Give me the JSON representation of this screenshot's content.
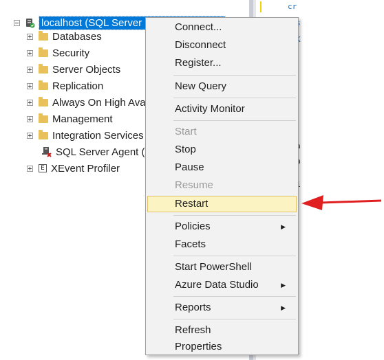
{
  "tree": {
    "server_label": "localhost (SQL Server 16.0.1000.6 - sa)",
    "items": [
      {
        "label": "Databases"
      },
      {
        "label": "Security"
      },
      {
        "label": "Server Objects"
      },
      {
        "label": "Replication"
      },
      {
        "label": "Always On High Availability"
      },
      {
        "label": "Management"
      },
      {
        "label": "Integration Services Catalogs"
      },
      {
        "label": "SQL Server Agent (Agent XPs disabled)"
      },
      {
        "label": "XEvent Profiler"
      }
    ]
  },
  "background_fragments": [
    "cr",
    "s",
    "K",
    "a",
    "a",
    "1"
  ],
  "context_menu": {
    "items": [
      {
        "label": "Connect..."
      },
      {
        "label": "Disconnect"
      },
      {
        "label": "Register..."
      },
      {
        "label": "New Query"
      },
      {
        "label": "Activity Monitor"
      },
      {
        "label": "Start"
      },
      {
        "label": "Stop"
      },
      {
        "label": "Pause"
      },
      {
        "label": "Resume"
      },
      {
        "label": "Restart"
      },
      {
        "label": "Policies"
      },
      {
        "label": "Facets"
      },
      {
        "label": "Start PowerShell"
      },
      {
        "label": "Azure Data Studio"
      },
      {
        "label": "Reports"
      },
      {
        "label": "Refresh"
      },
      {
        "label": "Properties"
      }
    ],
    "highlighted": "Restart",
    "disabled": [
      "Start",
      "Resume"
    ]
  },
  "colors": {
    "selection": "#0078d7",
    "highlight": "#fcf3c2",
    "arrow": "#e02020",
    "folder": "#e8c15a"
  }
}
